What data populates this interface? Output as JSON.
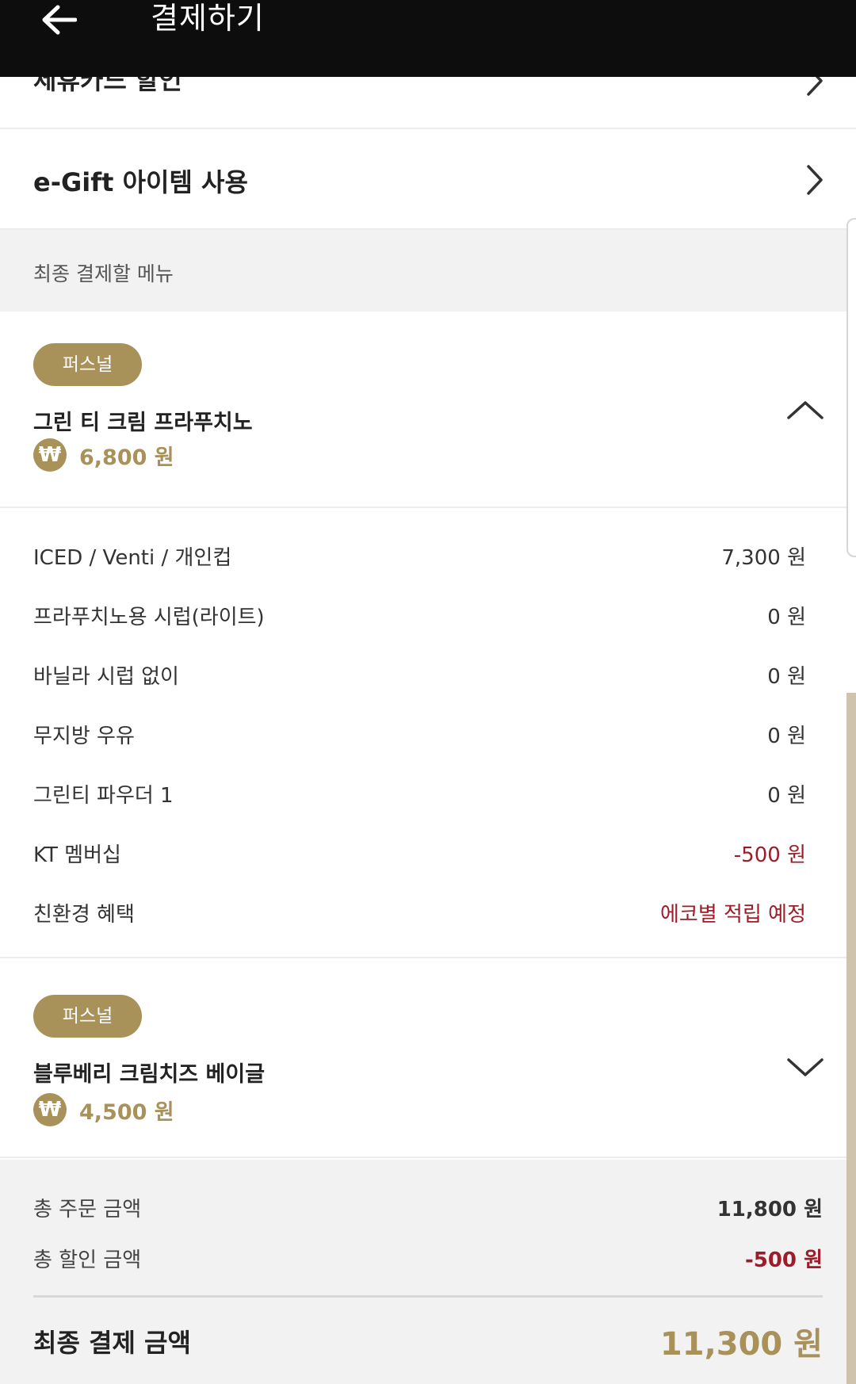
{
  "appbar": {
    "title": "결제하기",
    "back_icon": "arrow-left-icon"
  },
  "links": {
    "card_discount": "제휴카드 할인",
    "egift": "e-Gift 아이템 사용"
  },
  "section": {
    "title": "최종 결제할 메뉴"
  },
  "products": [
    {
      "badge": "퍼스널",
      "name": "그린 티 크림 프라푸치노",
      "price": "6,800 원",
      "expanded": true,
      "options": [
        {
          "label": "ICED / Venti / 개인컵",
          "value": "7,300 원",
          "highlight": false
        },
        {
          "label": "프라푸치노용 시럽(라이트)",
          "value": "0 원",
          "highlight": false
        },
        {
          "label": "바닐라 시럽 없이",
          "value": "0 원",
          "highlight": false
        },
        {
          "label": "무지방 우유",
          "value": "0 원",
          "highlight": false
        },
        {
          "label": "그린티 파우더 1",
          "value": "0 원",
          "highlight": false
        },
        {
          "label": "KT 멤버십",
          "value": "-500 원",
          "highlight": true
        },
        {
          "label": "친환경 혜택",
          "value": "에코별 적립 예정",
          "highlight": true
        }
      ]
    },
    {
      "badge": "퍼스널",
      "name": "블루베리 크림치즈 베이글",
      "price": "4,500 원",
      "expanded": false
    }
  ],
  "won_symbol": "₩",
  "summary": {
    "order_label": "총 주문 금액",
    "order_value": "11,800 원",
    "discount_label": "총 할인 금액",
    "discount_value": "-500 원",
    "final_label": "최종 결제 금액",
    "final_value": "11,300 원"
  },
  "colors": {
    "accent": "#a9915a",
    "discount": "#9c1c2a",
    "appbar": "#0d0d0d"
  }
}
